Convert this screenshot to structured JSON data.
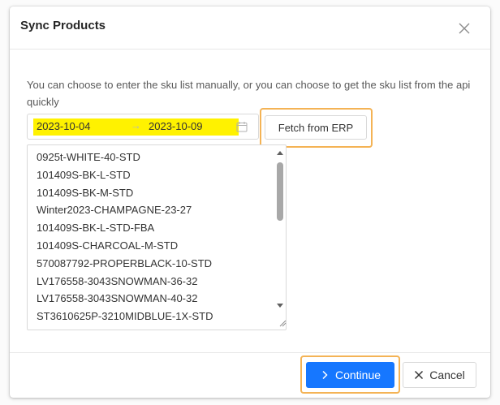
{
  "dialog": {
    "title": "Sync Products",
    "close_icon": "close-icon"
  },
  "body": {
    "description": "You can choose to enter the sku list manually, or you can choose to get the sku list from the api quickly",
    "date_range": {
      "start": "2023-10-04",
      "end": "2023-10-09",
      "separator": "→",
      "icon": "calendar-icon",
      "highlight_color": "#fff200"
    },
    "fetch_button_label": "Fetch from ERP",
    "sku_list": [
      "0925t-WHITE-40-STD",
      "101409S-BK-L-STD",
      "101409S-BK-M-STD",
      "Winter2023-CHAMPAGNE-23-27",
      "101409S-BK-L-STD-FBA",
      "101409S-CHARCOAL-M-STD",
      "570087792-PROPERBLACK-10-STD",
      "LV176558-3043SNOWMAN-36-32",
      "LV176558-3043SNOWMAN-40-32",
      "ST3610625P-3210MIDBLUE-1X-STD"
    ]
  },
  "footer": {
    "continue_label": "Continue",
    "continue_icon": "chevron-right-icon",
    "cancel_label": "Cancel",
    "cancel_icon": "close-icon"
  },
  "colors": {
    "primary": "#1677ff",
    "annotation_outline": "#f4b355"
  }
}
